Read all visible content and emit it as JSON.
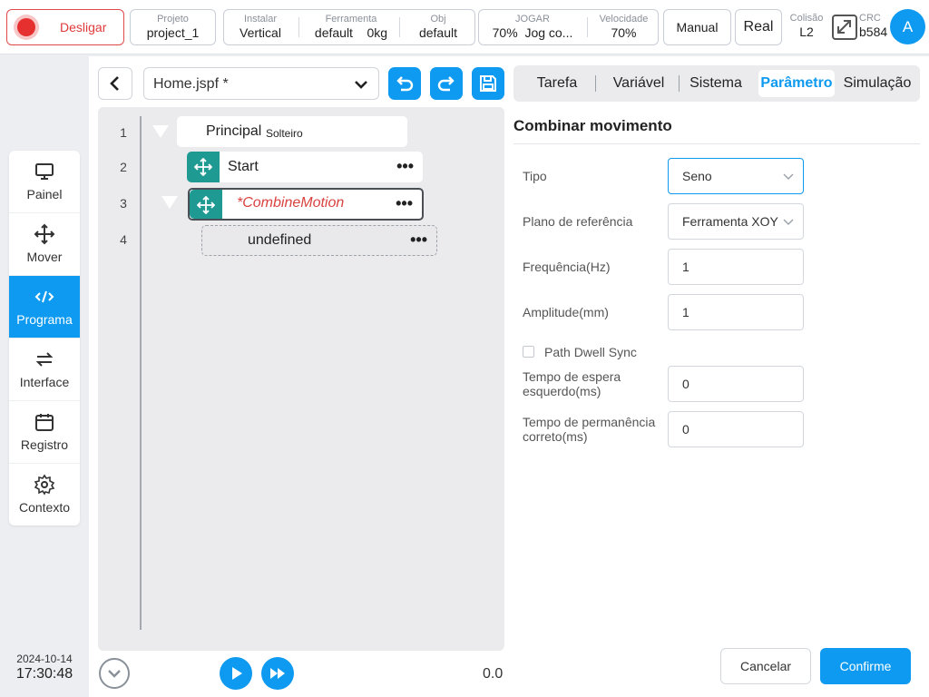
{
  "topbar": {
    "power_label": "Desligar",
    "project": {
      "label": "Projeto",
      "value": "project_1"
    },
    "install": {
      "label": "Instalar",
      "value": "Vertical"
    },
    "tool": {
      "label": "Ferramenta",
      "value": "default",
      "weight": "0kg"
    },
    "obj": {
      "label": "Obj",
      "value": "default"
    },
    "jog": {
      "label": "JOGAR",
      "value": "70%",
      "mode": "Jog co..."
    },
    "speed": {
      "label": "Velocidade",
      "value": "70%"
    },
    "manual_label": "Manual",
    "real_label": "Real",
    "collision": {
      "label": "Colisão",
      "value": "L2"
    },
    "crc": {
      "label": "CRC",
      "value": "b584"
    },
    "avatar_letter": "A"
  },
  "sidebar": {
    "items": [
      {
        "label": "Painel",
        "icon": "monitor-icon"
      },
      {
        "label": "Mover",
        "icon": "move-arrows-icon"
      },
      {
        "label": "Programa",
        "icon": "code-icon",
        "active": true
      },
      {
        "label": "Interface",
        "icon": "swap-arrows-icon"
      },
      {
        "label": "Registro",
        "icon": "calendar-icon"
      },
      {
        "label": "Contexto",
        "icon": "gear-icon"
      }
    ],
    "date": "2024-10-14",
    "time": "17:30:48"
  },
  "editor": {
    "file_name": "Home.jspf *",
    "tree": [
      {
        "line": "1",
        "label": "Principal",
        "sub": "Solteiro"
      },
      {
        "line": "2",
        "label": "Start"
      },
      {
        "line": "3",
        "label": "*CombineMotion"
      },
      {
        "line": "4",
        "label": "undefined"
      }
    ],
    "speed_readout": "0.0"
  },
  "tabs": [
    "Tarefa",
    "Variável",
    "Sistema",
    "Parâmetro",
    "Simulação"
  ],
  "active_tab": "Parâmetro",
  "form": {
    "title": "Combinar movimento",
    "tipo": {
      "label": "Tipo",
      "value": "Seno"
    },
    "plano": {
      "label": "Plano de referência",
      "value": "Ferramenta XOY"
    },
    "frequencia": {
      "label": "Frequência(Hz)",
      "value": "1"
    },
    "amplitude": {
      "label": "Amplitude(mm)",
      "value": "1"
    },
    "dwell_sync": {
      "label": "Path Dwell Sync",
      "checked": false
    },
    "espera_esq": {
      "label": "Tempo de espera esquerdo(ms)",
      "value": "0"
    },
    "permanencia": {
      "label": "Tempo de permanência correto(ms)",
      "value": "0"
    },
    "cancel_label": "Cancelar",
    "confirm_label": "Confirme"
  },
  "colors": {
    "accent": "#0e9af0",
    "node_teal": "#1f9a92",
    "power_red": "#e6302f",
    "modified_red": "#d9423f"
  }
}
